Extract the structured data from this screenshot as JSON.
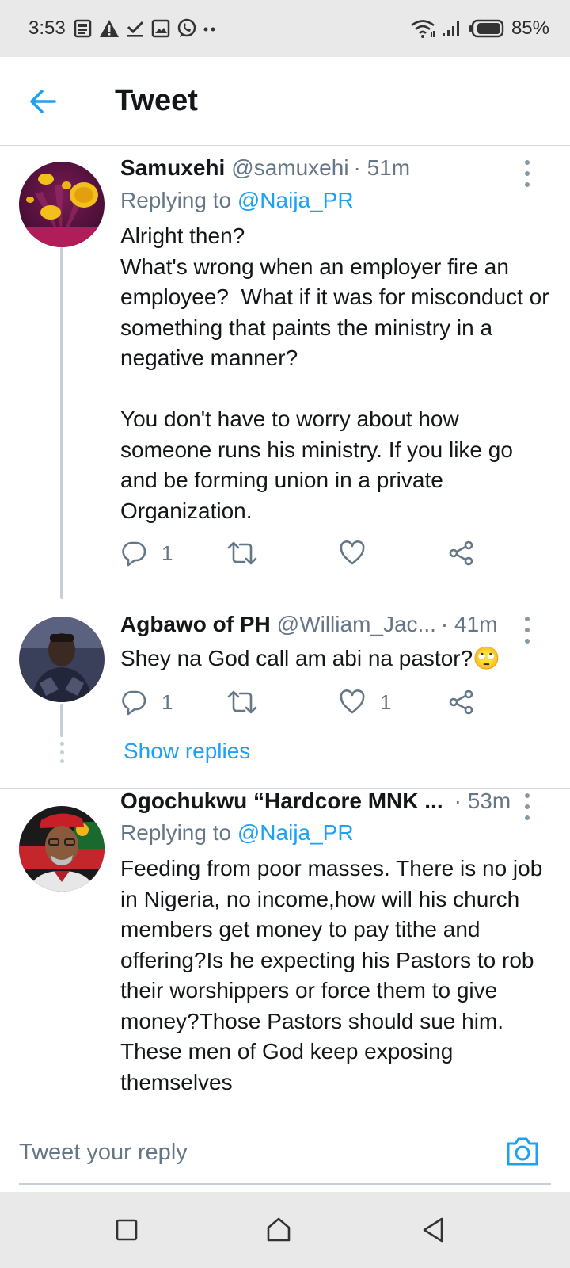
{
  "status_bar": {
    "time": "3:53",
    "battery_percent": "85%",
    "left_icons": [
      "news-icon",
      "warning-icon",
      "check-icon",
      "image-icon",
      "whatsapp-icon",
      "more-dots-icon"
    ],
    "right_icons": [
      "wifi-icon",
      "signal-icon",
      "battery-icon"
    ]
  },
  "header": {
    "title": "Tweet"
  },
  "tweets": [
    {
      "name": "Samuxehi",
      "handle": "@samuxehi",
      "time": "· 51m",
      "replying_prefix": "Replying to ",
      "replying_to": "@Naija_PR",
      "text": "Alright then?\nWhat's wrong when an employer fire an employee?  What if it was for misconduct or something that paints the ministry in a negative manner?\n\nYou don't have to worry about how someone runs his ministry. If you like go and be forming union in a private Organization.",
      "reply_count": "1",
      "retweet_count": "",
      "like_count": ""
    },
    {
      "name": "Agbawo of PH",
      "handle": "@William_Jac...",
      "time": "· 41m",
      "text": "Shey na God call am abi na pastor?🙄",
      "reply_count": "1",
      "retweet_count": "",
      "like_count": "1",
      "show_replies": "Show replies"
    },
    {
      "name": "Ogochukwu “Hardcore MNK ...",
      "handle": "",
      "time": "· 53m",
      "replying_prefix": "Replying to ",
      "replying_to": "@Naija_PR",
      "text": "Feeding from poor masses. There is no job in Nigeria, no income,how will his church members get money to pay tithe and offering?Is he expecting his Pastors to rob their worshippers or force them to give money?Those Pastors should sue him. These men of God keep exposing themselves"
    }
  ],
  "reply_bar": {
    "placeholder": "Tweet your reply"
  },
  "colors": {
    "accent": "#1da1f2",
    "text_primary": "#14171a",
    "text_secondary": "#657786",
    "divider": "#d5dbe0",
    "system_bar": "#e9e9ea"
  }
}
